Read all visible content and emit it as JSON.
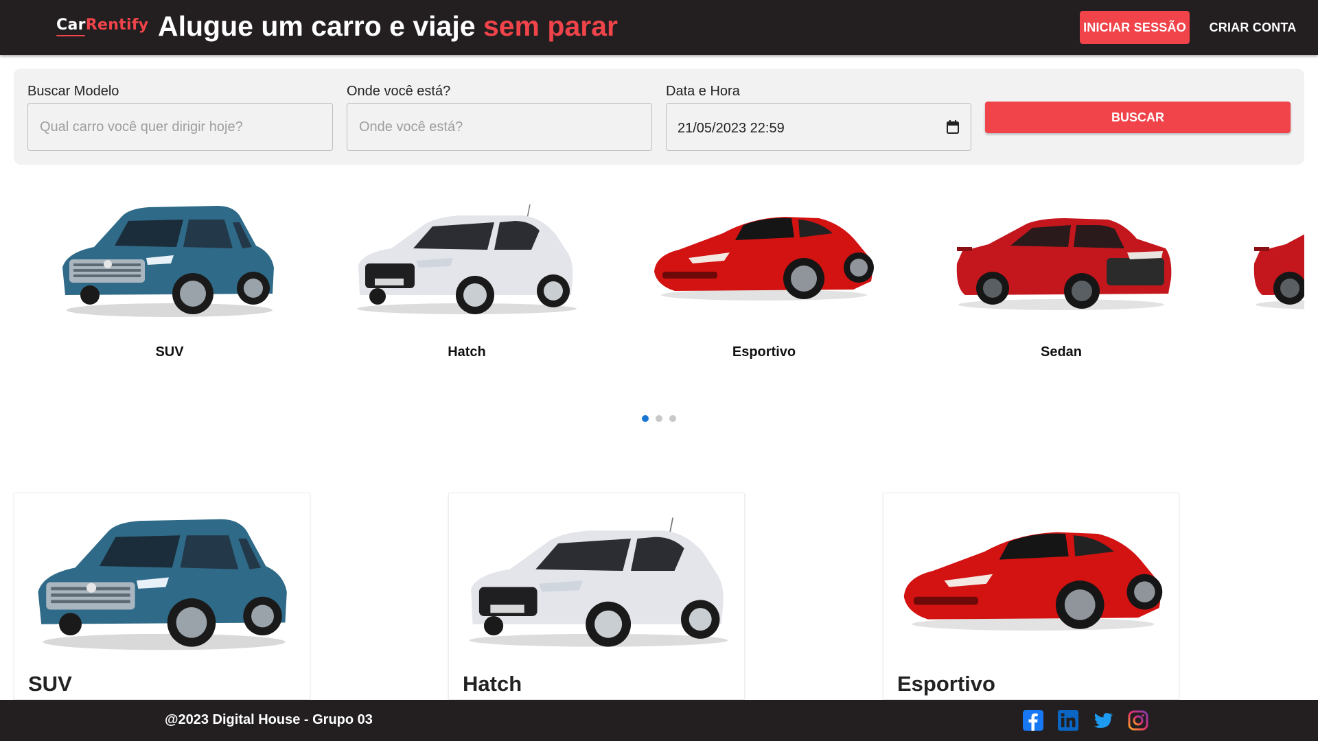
{
  "header": {
    "logo": {
      "part1": "Car",
      "part2": "Rentify"
    },
    "tagline": {
      "main": "Alugue um carro e viaje ",
      "accent": "sem parar"
    },
    "login_label": "INICIAR SESSÃO",
    "signup_label": "CRIAR CONTA"
  },
  "search": {
    "model": {
      "label": "Buscar Modelo",
      "placeholder": "Qual carro você quer dirigir hoje?"
    },
    "location": {
      "label": "Onde você está?",
      "placeholder": "Onde você está?"
    },
    "datetime": {
      "label": "Data e Hora",
      "value": "21/05/2023 22:59",
      "icon": "calendar-icon"
    },
    "button_label": "BUSCAR"
  },
  "carousel": {
    "items": [
      {
        "label": "SUV"
      },
      {
        "label": "Hatch"
      },
      {
        "label": "Esportivo"
      },
      {
        "label": "Sedan"
      }
    ],
    "pages": 3,
    "active_page": 1
  },
  "cards": [
    {
      "title": "SUV"
    },
    {
      "title": "Hatch"
    },
    {
      "title": "Esportivo"
    }
  ],
  "footer": {
    "copyright": "@2023 Digital House - Grupo 03",
    "socials": [
      "facebook-icon",
      "linkedin-icon",
      "twitter-icon",
      "instagram-icon"
    ]
  },
  "colors": {
    "accent": "#f0444a",
    "header_bg": "#231f20",
    "suv": "#2e6a8a",
    "hatch": "#e8e8ec",
    "sports": "#d01010",
    "sedan": "#c0161c"
  }
}
